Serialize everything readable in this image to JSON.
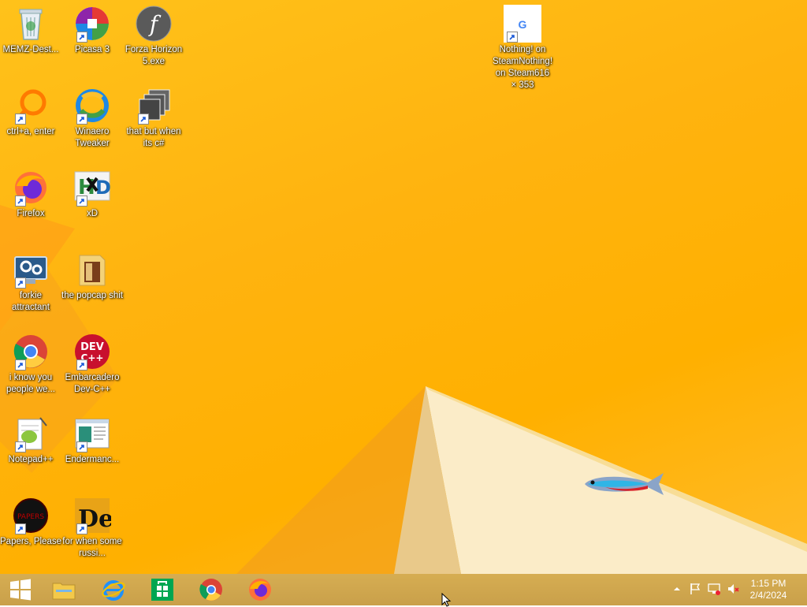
{
  "desktop": {
    "icons": [
      {
        "name": "recycle-bin-icon",
        "label": "MEMZ-Dest..."
      },
      {
        "name": "picasa-icon",
        "label": "Picasa 3"
      },
      {
        "name": "flash-icon",
        "label": "Forza Horizon 5.exe"
      },
      {
        "name": "ccleaner-ring-icon",
        "label": "ctrl+a, enter"
      },
      {
        "name": "winaero-icon",
        "label": "Winaero Tweaker"
      },
      {
        "name": "stacked-windows-icon",
        "label": "that but when its c#"
      },
      {
        "name": "firefox-icon",
        "label": "Firefox"
      },
      {
        "name": "hxd-icon",
        "label": "xD"
      },
      {
        "name": "settings-monitor-icon",
        "label": "forkie attractant"
      },
      {
        "name": "folder-icon",
        "label": "the popcap shit"
      },
      {
        "name": "chrome-icon",
        "label": "i know you people we..."
      },
      {
        "name": "devcpp-icon",
        "label": "Embarcadero Dev-C++"
      },
      {
        "name": "notepadpp-icon",
        "label": "Notepad++"
      },
      {
        "name": "document-window-icon",
        "label": "Endermanc..."
      },
      {
        "name": "papers-please-icon",
        "label": "Papers, Please"
      },
      {
        "name": "de-icon",
        "label": "for when some russi..."
      },
      {
        "name": "google-icon",
        "label": "Nothing! on SteamNothing! on Steam616 × 353"
      }
    ]
  },
  "taskbar": {
    "pinned": [
      {
        "name": "start-button",
        "icon": "windows-logo-icon"
      },
      {
        "name": "file-explorer-button",
        "icon": "folder-icon"
      },
      {
        "name": "internet-explorer-button",
        "icon": "ie-icon"
      },
      {
        "name": "store-button",
        "icon": "store-icon"
      },
      {
        "name": "chrome-button",
        "icon": "chrome-icon"
      },
      {
        "name": "firefox-button",
        "icon": "firefox-icon"
      }
    ],
    "clock": {
      "time": "1:15 PM",
      "date": "2/4/2024"
    }
  },
  "colors": {
    "wallpaper": "#ffb400",
    "taskbar": "#cfa64e",
    "accent": "#ffffff"
  }
}
